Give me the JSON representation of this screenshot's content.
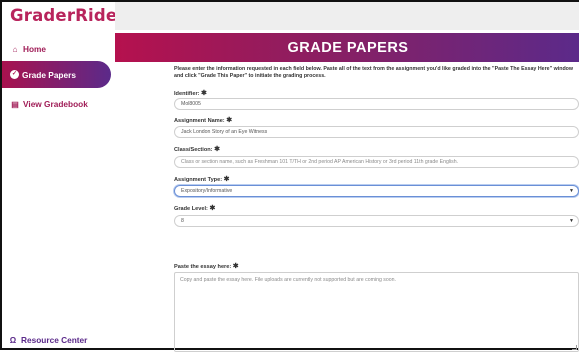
{
  "app": {
    "logo": "GraderRide"
  },
  "sidebar": {
    "home": "Home",
    "grade_papers": "Grade Papers",
    "gradebook": "View Gradebook",
    "resource_center": "Resource Center"
  },
  "banner": {
    "title": "GRADE PAPERS"
  },
  "form": {
    "instructions": "Please enter the information requested in each field below. Paste all of the text from the assignment you'd like graded into the \"Paste The Essay Here\" window and click \"Grade This Paper\" to initiate the grading process.",
    "identifier": {
      "label": "Identifier:",
      "value": "Mol8005"
    },
    "assignment_name": {
      "label": "Assignment Name:",
      "value": "Jack London Story of an Eye Witness"
    },
    "class_section": {
      "label": "Class/Section:",
      "placeholder": "Class or section name, such as Freshman 101 T/TH or 2nd period AP American History or 3rd period 11th grade English."
    },
    "assignment_type": {
      "label": "Assignment Type:",
      "value": "Expository/Informative"
    },
    "grade_level": {
      "label": "Grade Level:",
      "value": "8"
    },
    "essay": {
      "label": "Paste the essay here:",
      "placeholder": "Copy and paste the essay here. File uploads are currently not supported but are coming soon."
    }
  },
  "colors": {
    "brand": "#b8245c",
    "purple": "#5b2a8a"
  },
  "icons": [
    "home-icon",
    "grade-papers-icon",
    "chart-icon",
    "headphones-icon",
    "chevron-down-icon"
  ]
}
